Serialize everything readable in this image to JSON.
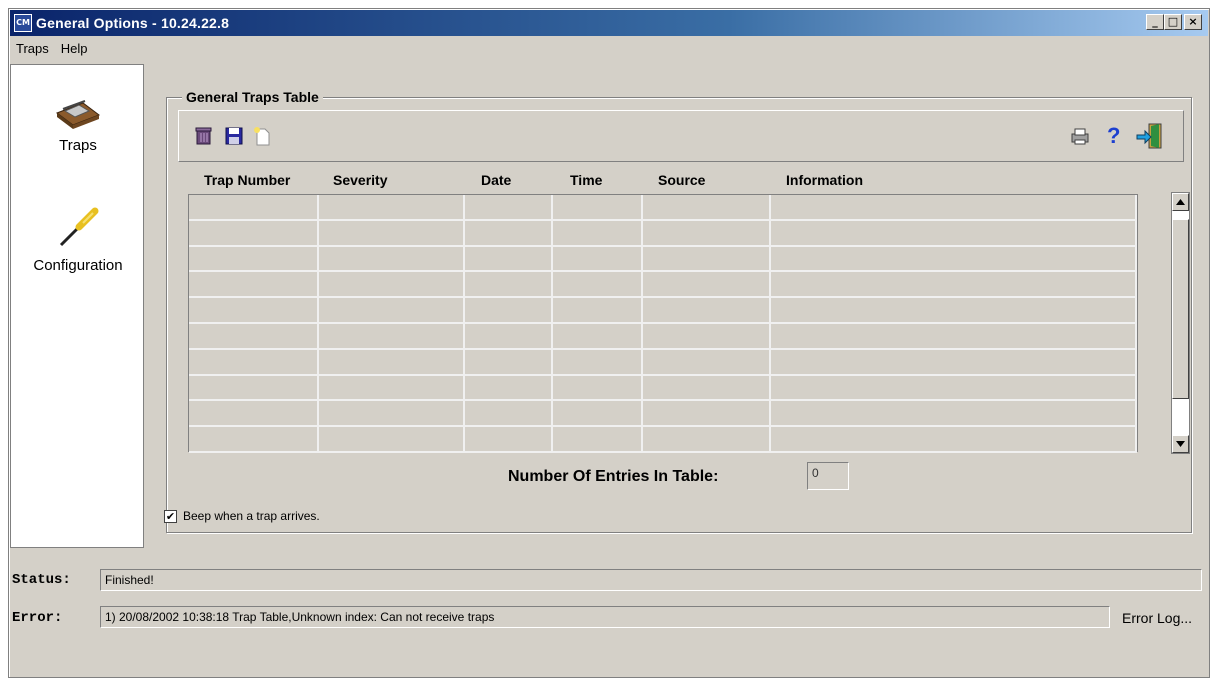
{
  "window": {
    "app_icon_text": "CM",
    "title": "General Options - 10.24.22.8",
    "minimize": "_",
    "maximize": "□",
    "close": "×"
  },
  "menu": {
    "items": [
      "Traps",
      "Help"
    ]
  },
  "sidebar": {
    "items": [
      {
        "label": "Traps",
        "icon": "mousetrap-icon"
      },
      {
        "label": "Configuration",
        "icon": "screwdriver-icon"
      }
    ]
  },
  "group": {
    "title": "General Traps Table"
  },
  "toolbar": {
    "left_icons": [
      "trash-icon",
      "save-disk-icon",
      "new-document-icon"
    ],
    "right_icons": [
      "printer-icon",
      "help-question-icon",
      "exit-door-icon"
    ],
    "help_glyph": "?"
  },
  "table": {
    "columns": [
      "Trap Number",
      "Severity",
      "Date",
      "Time",
      "Source",
      "Information"
    ],
    "rows": []
  },
  "entries": {
    "label": "Number Of Entries In Table:",
    "value": "0"
  },
  "beep": {
    "label": "Beep when a trap arrives.",
    "checked": true,
    "check_glyph": "✔"
  },
  "status": {
    "label": "Status:",
    "value": "Finished!"
  },
  "error": {
    "label": "Error:",
    "value": "1) 20/08/2002 10:38:18 Trap Table,Unknown index: Can not receive traps",
    "log_label": "Error Log..."
  },
  "colors": {
    "title_gradient_start": "#0a246a",
    "title_gradient_end": "#a6caf0",
    "face": "#d4d0c8",
    "help_blue": "#1c3fd0"
  }
}
